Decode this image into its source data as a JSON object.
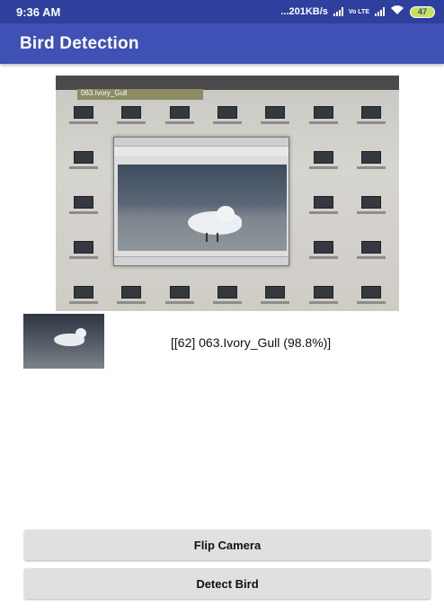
{
  "status_bar": {
    "time": "9:36 AM",
    "network_speed": "...201KB/s",
    "lte_label": "Vo LTE",
    "battery": "47"
  },
  "app_bar": {
    "title": "Bird Detection"
  },
  "camera_preview": {
    "tab_label": "063.Ivory_Gull"
  },
  "result": {
    "text": "[[62] 063.Ivory_Gull (98.8%)]"
  },
  "buttons": {
    "flip_camera": "Flip Camera",
    "detect_bird": "Detect Bird"
  },
  "colors": {
    "status_bar": "#2f3f9e",
    "app_bar": "#3f51b5",
    "button_bg": "#e0e0e0"
  }
}
